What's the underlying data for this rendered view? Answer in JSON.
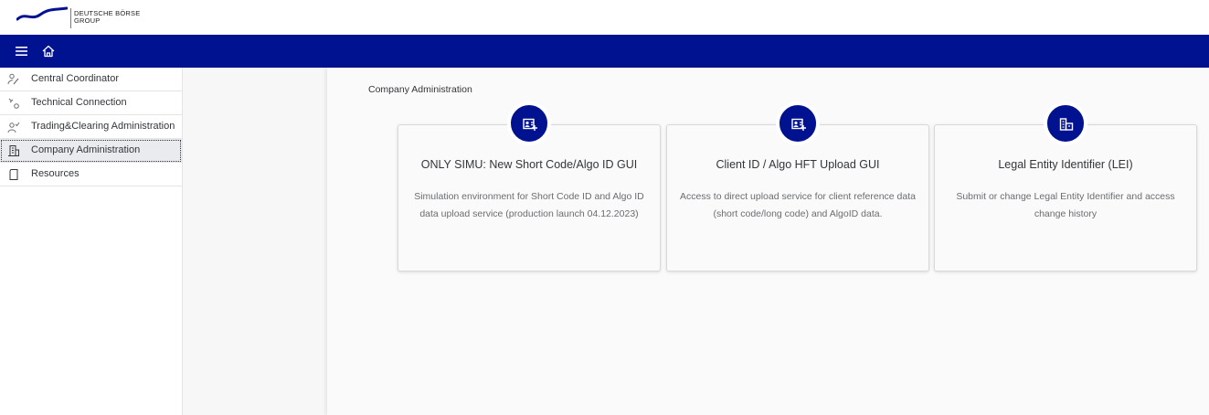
{
  "brand": {
    "line1": "DEUTSCHE BÖRSE",
    "line2": "GROUP"
  },
  "shellbar": {
    "menu_icon": "hamburger-icon",
    "home_icon": "home-icon"
  },
  "sidenav": {
    "items": [
      {
        "label": "Central Coordinator",
        "icon": "person-edit-icon"
      },
      {
        "label": "Technical Connection",
        "icon": "connection-icon"
      },
      {
        "label": "Trading&Clearing Administration",
        "icon": "person-check-icon"
      },
      {
        "label": "Company Administration",
        "icon": "building-icon",
        "selected": true
      },
      {
        "label": "Resources",
        "icon": "document-icon"
      }
    ]
  },
  "main": {
    "breadcrumb": "Company Administration",
    "cards": [
      {
        "title": "ONLY SIMU: New Short Code/Algo ID GUI",
        "description": "Simulation environment for Short Code ID and Algo ID data upload service (production launch 04.12.2023)",
        "icon": "id-card-icon"
      },
      {
        "title": "Client ID / Algo HFT Upload GUI",
        "description": "Access to direct upload service for client reference data (short code/long code) and AlgoID data.",
        "icon": "id-card-icon"
      },
      {
        "title": "Legal Entity Identifier (LEI)",
        "description": "Submit or change Legal Entity Identifier and access change history",
        "icon": "buildings-icon"
      }
    ]
  },
  "colors": {
    "shellbar": "#00128f",
    "badge": "#00128f"
  }
}
